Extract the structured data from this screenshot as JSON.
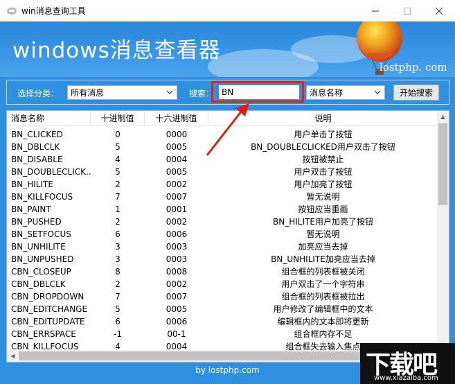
{
  "window": {
    "title": "win消息查询工具"
  },
  "banner": {
    "title": "windows消息查看器",
    "url": "lostphp. com"
  },
  "search": {
    "category_label": "选择分类：",
    "category_value": "所有消息",
    "keyword_label": "搜索：",
    "keyword_value": "BN",
    "field_value": "消息名称",
    "start_button": "开始搜索"
  },
  "table": {
    "columns": [
      "消息名称",
      "十进制值",
      "十六进制值",
      "说明"
    ],
    "rows": [
      [
        "BN_CLICKED",
        "0",
        "0000",
        "用户单击了按钮"
      ],
      [
        "BN_DBLCLK",
        "5",
        "0005",
        "BN_DOUBLECLICKED用户双击了按钮"
      ],
      [
        "BN_DISABLE",
        "4",
        "0004",
        "按钮被禁止"
      ],
      [
        "BN_DOUBLECLICK...",
        "5",
        "0005",
        "用户双击了按钮"
      ],
      [
        "BN_HILITE",
        "2",
        "0002",
        "用户加亮了按钮"
      ],
      [
        "BN_KILLFOCUS",
        "7",
        "0007",
        "暂无说明"
      ],
      [
        "BN_PAINT",
        "1",
        "0001",
        "按钮应当重画"
      ],
      [
        "BN_PUSHED",
        "2",
        "0002",
        "BN_HILITE用户加亮了按钮"
      ],
      [
        "BN_SETFOCUS",
        "6",
        "0006",
        "暂无说明"
      ],
      [
        "BN_UNHILITE",
        "3",
        "0003",
        "加亮应当去掉"
      ],
      [
        "BN_UNPUSHED",
        "3",
        "0003",
        "BN_UNHILITE加亮应当去掉"
      ],
      [
        "CBN_CLOSEUP",
        "8",
        "0008",
        "组合框的列表框被关闭"
      ],
      [
        "CBN_DBLCLK",
        "2",
        "0002",
        "用户双击了一个字符串"
      ],
      [
        "CBN_DROPDOWN",
        "7",
        "0007",
        "组合框的列表框被拉出"
      ],
      [
        "CBN_EDITCHANGE",
        "5",
        "0005",
        "用户修改了编辑框中的文本"
      ],
      [
        "CBN_EDITUPDATE",
        "6",
        "0006",
        "编辑框内的文本即将更新"
      ],
      [
        "CBN_ERRSPACE",
        "-1",
        "00-1",
        "组合框内存不足"
      ],
      [
        "CBN_KILLFOCUS",
        "4",
        "0004",
        "组合框失去输入焦点"
      ]
    ]
  },
  "footer": {
    "text": "by lostphp.com"
  },
  "watermark": {
    "big": "下载吧",
    "small": "www.xiazaiba.com"
  },
  "colors": {
    "window_bg": "#2f8fe0",
    "highlight": "#e0231a"
  }
}
